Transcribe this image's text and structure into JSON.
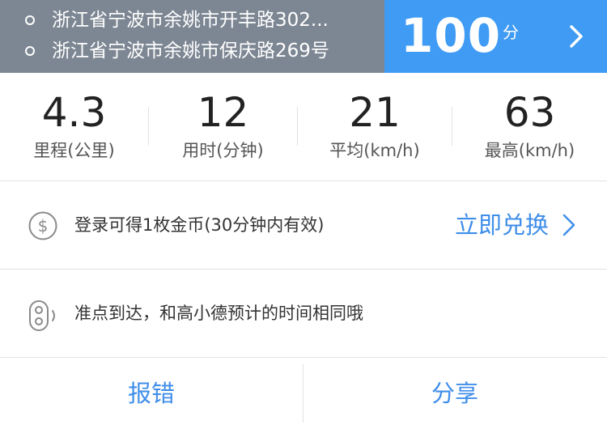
{
  "route": {
    "origin": "浙江省宁波市余姚市开丰路302...",
    "destination": "浙江省宁波市余姚市保庆路269号"
  },
  "score": {
    "value": "100",
    "unit": "分",
    "arrow_icon": "chevron-right-icon"
  },
  "stats": [
    {
      "value": "4.3",
      "label": "里程(公里)"
    },
    {
      "value": "12",
      "label": "用时(分钟)"
    },
    {
      "value": "21",
      "label": "平均(km/h)"
    },
    {
      "value": "63",
      "label": "最高(km/h)"
    }
  ],
  "coin_row": {
    "icon": "dollar-coin-icon",
    "text": "登录可得1枚金币(30分钟内有效)",
    "action_label": "立即兑换"
  },
  "tip_row": {
    "icon": "traffic-light-icon",
    "text": "准点到达，和高小德预计的时间相同哦"
  },
  "footer": {
    "report_label": "报错",
    "share_label": "分享"
  },
  "colors": {
    "route_bg": "#7d8793",
    "score_bg": "#3f9bf4",
    "accent": "#3f8ee9"
  }
}
